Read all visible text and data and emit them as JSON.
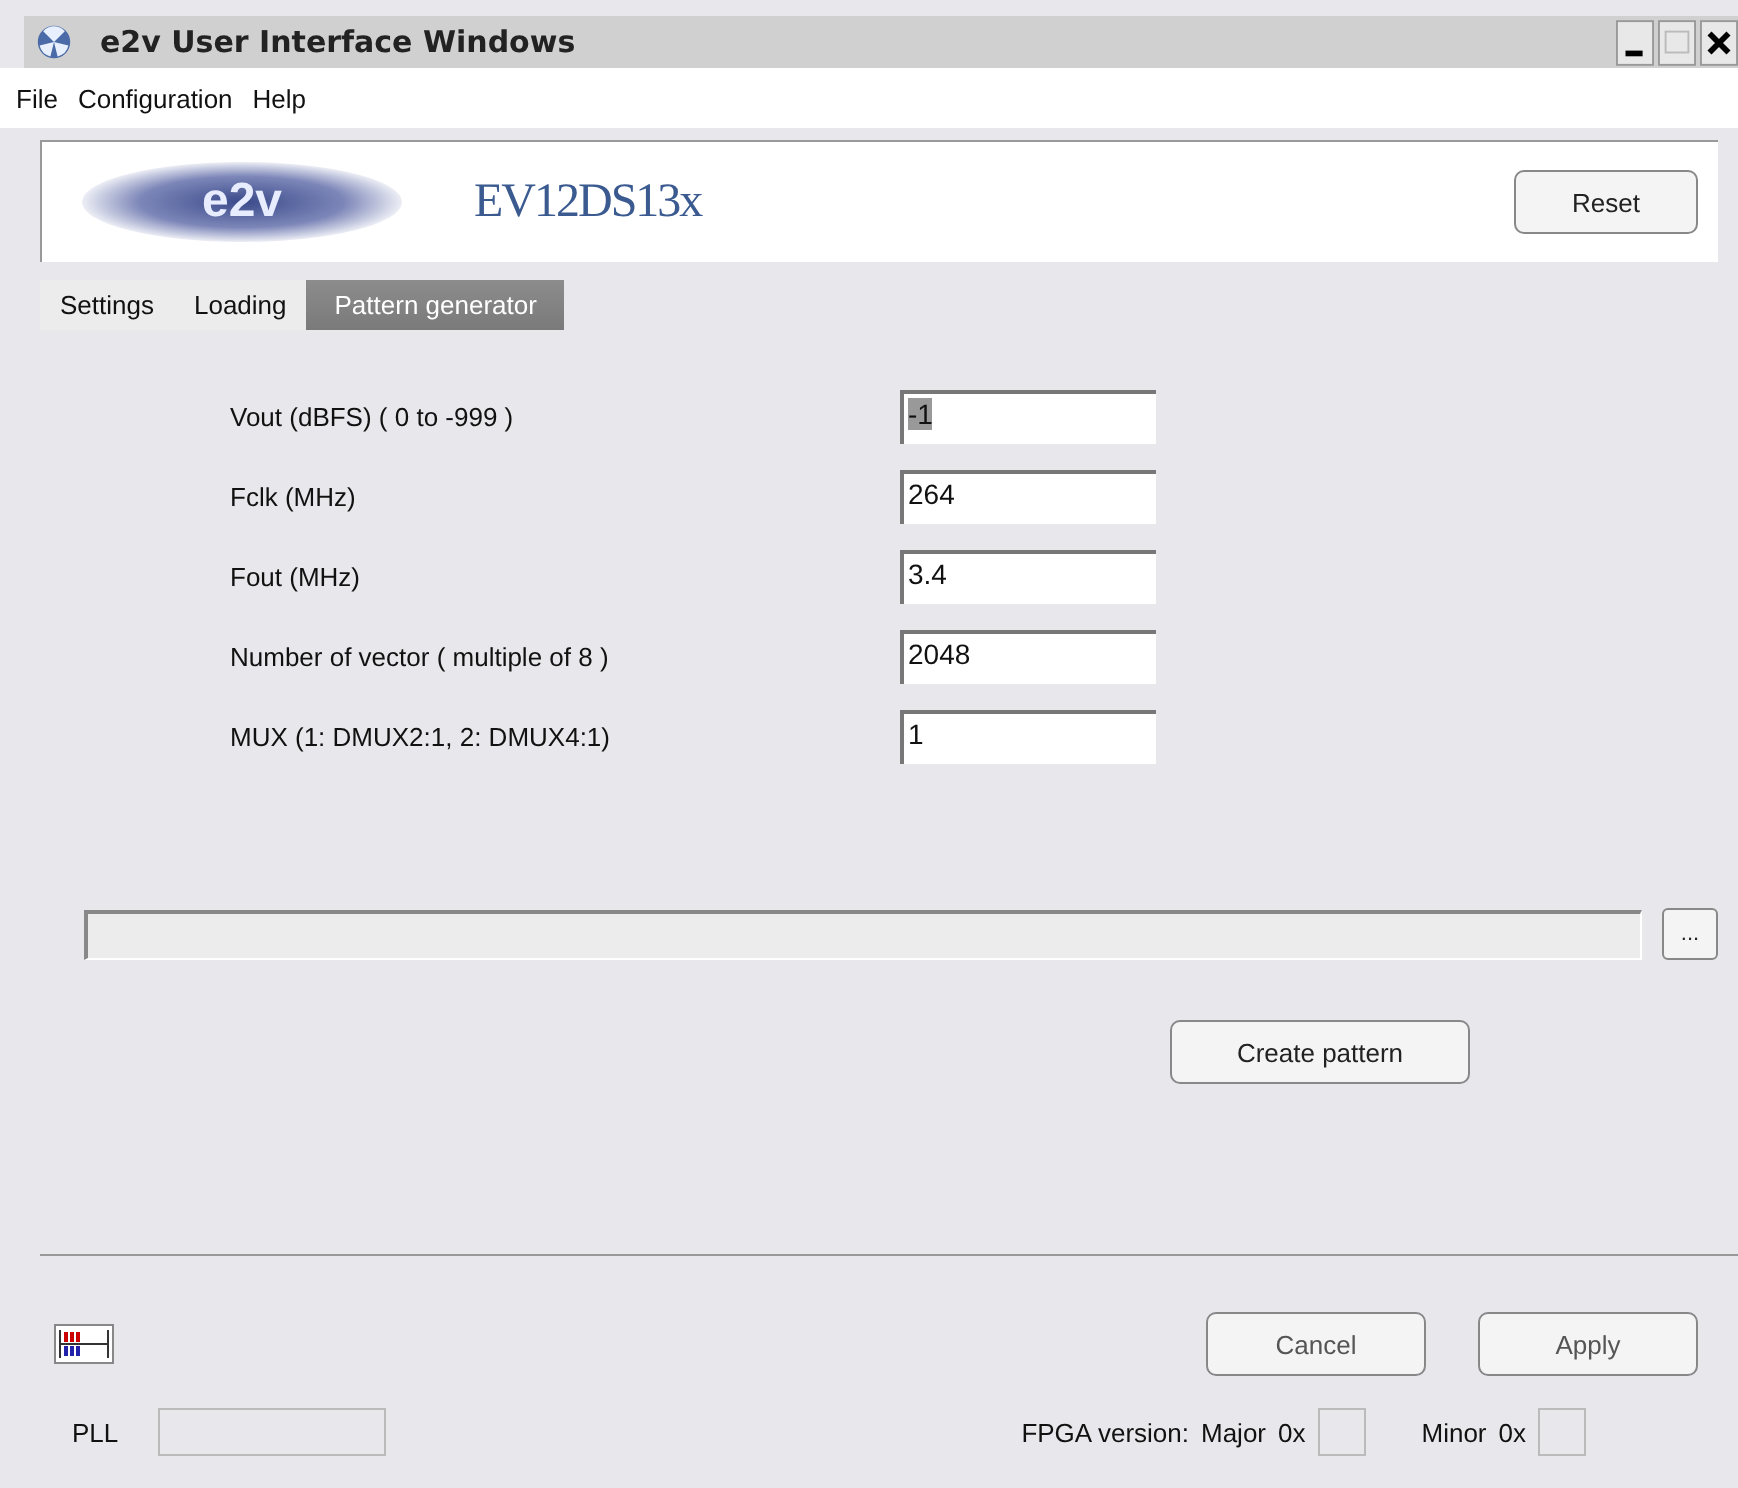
{
  "window": {
    "title": "e2v User Interface Windows"
  },
  "menu": [
    "File",
    "Configuration",
    "Help"
  ],
  "header": {
    "logo": "e2v",
    "product": "EV12DS13x",
    "reset_button": "Reset"
  },
  "tabs": [
    {
      "label": "Settings",
      "selected": false
    },
    {
      "label": "Loading",
      "selected": false
    },
    {
      "label": "Pattern generator",
      "selected": true
    }
  ],
  "fields": [
    {
      "label": "Vout (dBFS) ( 0 to -999 )",
      "value": "-1",
      "highlighted": true
    },
    {
      "label": "Fclk (MHz)",
      "value": "264",
      "highlighted": false
    },
    {
      "label": "Fout (MHz)",
      "value": "3.4",
      "highlighted": false
    },
    {
      "label": "Number of vector ( multiple of 8 )",
      "value": "2048",
      "highlighted": false
    },
    {
      "label": "MUX (1: DMUX2:1,  2: DMUX4:1)",
      "value": "1",
      "highlighted": false
    }
  ],
  "browse_button": "...",
  "create_button": "Create pattern",
  "buttons": [
    "Cancel",
    "Apply"
  ],
  "status": {
    "pll_label": "PLL",
    "fpga_label": "FPGA version:",
    "major_label": "Major",
    "major_prefix": "0x",
    "minor_label": "Minor",
    "minor_prefix": "0x"
  }
}
